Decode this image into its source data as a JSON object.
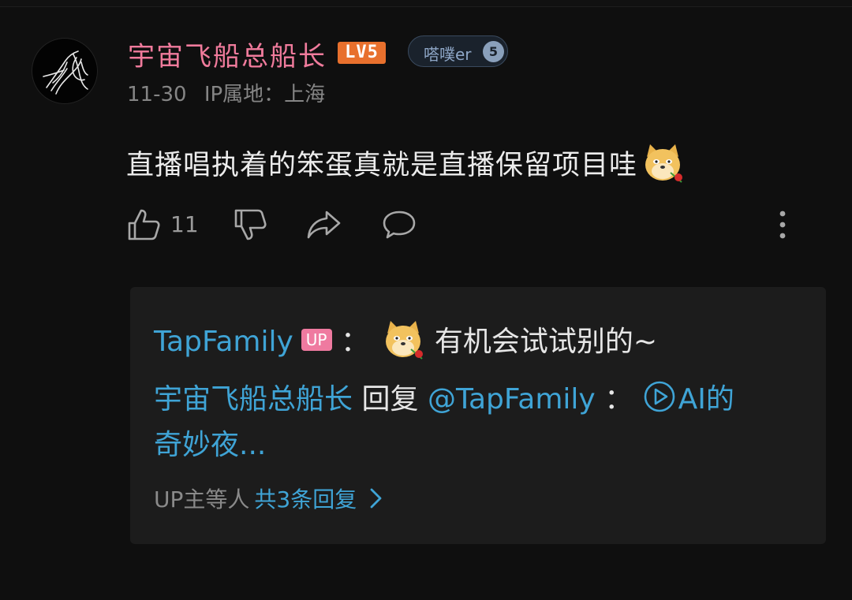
{
  "comment": {
    "username": "宇宙飞船总船长",
    "level_badge": "LV5",
    "fan_badge": {
      "label": "嗒噗er",
      "level": "5"
    },
    "date": "11-30",
    "ip_location": "IP属地：上海",
    "text": "直播唱执着的笨蛋真就是直播保留项目哇",
    "emoji": "doge-rose-emoji",
    "likes": "11"
  },
  "replies": {
    "first": {
      "author": "TapFamily",
      "tag": "UP",
      "separator": "：",
      "emoji": "doge-rose-emoji",
      "text": "有机会试试别的~"
    },
    "second": {
      "author": "宇宙飞船总船长",
      "action": "回复",
      "mention": "@TapFamily",
      "separator": "：",
      "link_text": "AI的",
      "text_cont": "奇妙夜..."
    },
    "footer": {
      "prefix": "UP主等人",
      "more": "共3条回复"
    }
  },
  "colors": {
    "username": "#f07b9c",
    "link": "#3fa4d6",
    "level_badge": "#e8702d",
    "up_tag": "#ef7aa0",
    "background": "#0f0f0f",
    "reply_box": "#1c1c1c"
  }
}
